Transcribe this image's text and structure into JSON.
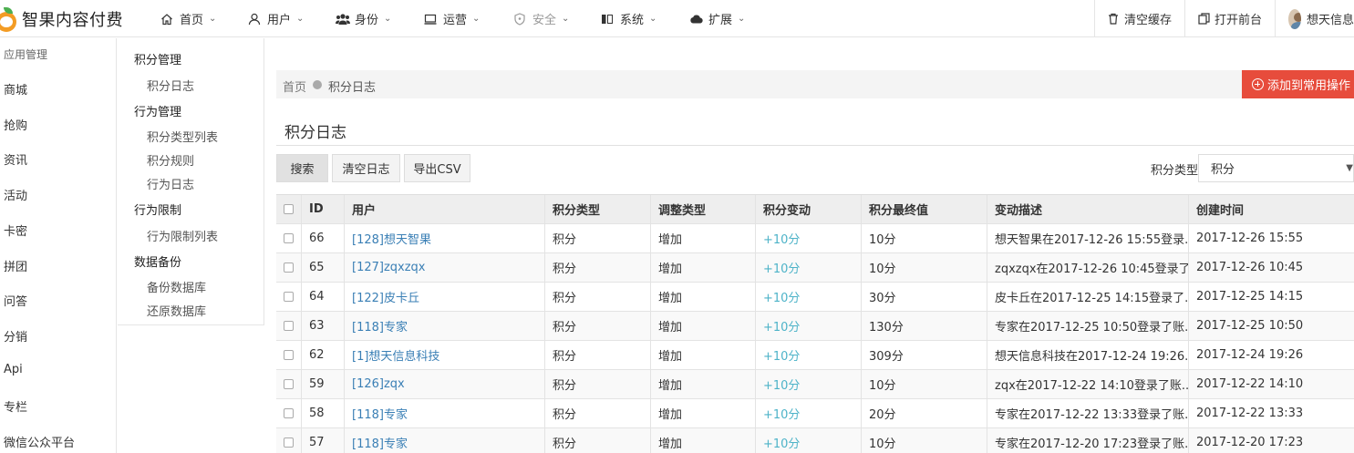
{
  "app": {
    "title": "智果内容付费"
  },
  "topnav": [
    {
      "label": "首页",
      "icon": "home-icon",
      "disabled": false
    },
    {
      "label": "用户",
      "icon": "user-icon",
      "disabled": false
    },
    {
      "label": "身份",
      "icon": "users-icon",
      "disabled": false
    },
    {
      "label": "运营",
      "icon": "monitor-icon",
      "disabled": false
    },
    {
      "label": "安全",
      "icon": "shield-icon",
      "disabled": true
    },
    {
      "label": "系统",
      "icon": "columns-icon",
      "disabled": false
    },
    {
      "label": "扩展",
      "icon": "cloud-icon",
      "disabled": false
    }
  ],
  "topright": {
    "clear_cache": "清空缓存",
    "open_front": "打开前台",
    "user_name": "想天信息"
  },
  "sidebar1": {
    "title": "应用管理",
    "items": [
      "商城",
      "抢购",
      "资讯",
      "活动",
      "卡密",
      "拼团",
      "问答",
      "分销",
      "Api",
      "专栏",
      "微信公众平台"
    ]
  },
  "sidebar2": {
    "groups": [
      {
        "label": "积分管理",
        "items": [
          "积分日志"
        ]
      },
      {
        "label": "行为管理",
        "items": [
          "积分类型列表",
          "积分规则",
          "行为日志"
        ]
      },
      {
        "label": "行为限制",
        "items": [
          "行为限制列表"
        ]
      },
      {
        "label": "数据备份",
        "items": [
          "备份数据库",
          "还原数据库"
        ]
      }
    ]
  },
  "breadcrumb": {
    "home": "首页",
    "current": "积分日志"
  },
  "add_button": "添加到常用操作",
  "page_title": "积分日志",
  "toolbar": {
    "search": "搜索",
    "clear_log": "清空日志",
    "export_csv": "导出CSV"
  },
  "filter": {
    "label": "积分类型",
    "value": "积分"
  },
  "table": {
    "columns": [
      "",
      "ID",
      "用户",
      "积分类型",
      "调整类型",
      "积分变动",
      "积分最终值",
      "变动描述",
      "创建时间"
    ],
    "rows": [
      {
        "id": "66",
        "user": "[128]想天智果",
        "type": "积分",
        "adjust": "增加",
        "change": "+10分",
        "final": "10分",
        "desc": "想天智果在2017-12-26 15:55登录...",
        "created": "2017-12-26 15:55"
      },
      {
        "id": "65",
        "user": "[127]zqxzqx",
        "type": "积分",
        "adjust": "增加",
        "change": "+10分",
        "final": "10分",
        "desc": "zqxzqx在2017-12-26 10:45登录了...",
        "created": "2017-12-26 10:45"
      },
      {
        "id": "64",
        "user": "[122]皮卡丘",
        "type": "积分",
        "adjust": "增加",
        "change": "+10分",
        "final": "30分",
        "desc": "皮卡丘在2017-12-25 14:15登录了...",
        "created": "2017-12-25 14:15"
      },
      {
        "id": "63",
        "user": "[118]专家",
        "type": "积分",
        "adjust": "增加",
        "change": "+10分",
        "final": "130分",
        "desc": "专家在2017-12-25 10:50登录了账...",
        "created": "2017-12-25 10:50"
      },
      {
        "id": "62",
        "user": "[1]想天信息科技",
        "type": "积分",
        "adjust": "增加",
        "change": "+10分",
        "final": "309分",
        "desc": "想天信息科技在2017-12-24 19:26...",
        "created": "2017-12-24 19:26"
      },
      {
        "id": "59",
        "user": "[126]zqx",
        "type": "积分",
        "adjust": "增加",
        "change": "+10分",
        "final": "10分",
        "desc": "zqx在2017-12-22 14:10登录了账...",
        "created": "2017-12-22 14:10"
      },
      {
        "id": "58",
        "user": "[118]专家",
        "type": "积分",
        "adjust": "增加",
        "change": "+10分",
        "final": "20分",
        "desc": "专家在2017-12-22 13:33登录了账...",
        "created": "2017-12-22 13:33"
      },
      {
        "id": "57",
        "user": "[118]专家",
        "type": "积分",
        "adjust": "增加",
        "change": "+10分",
        "final": "10分",
        "desc": "专家在2017-12-20 17:23登录了账...",
        "created": "2017-12-20 17:23"
      }
    ]
  }
}
